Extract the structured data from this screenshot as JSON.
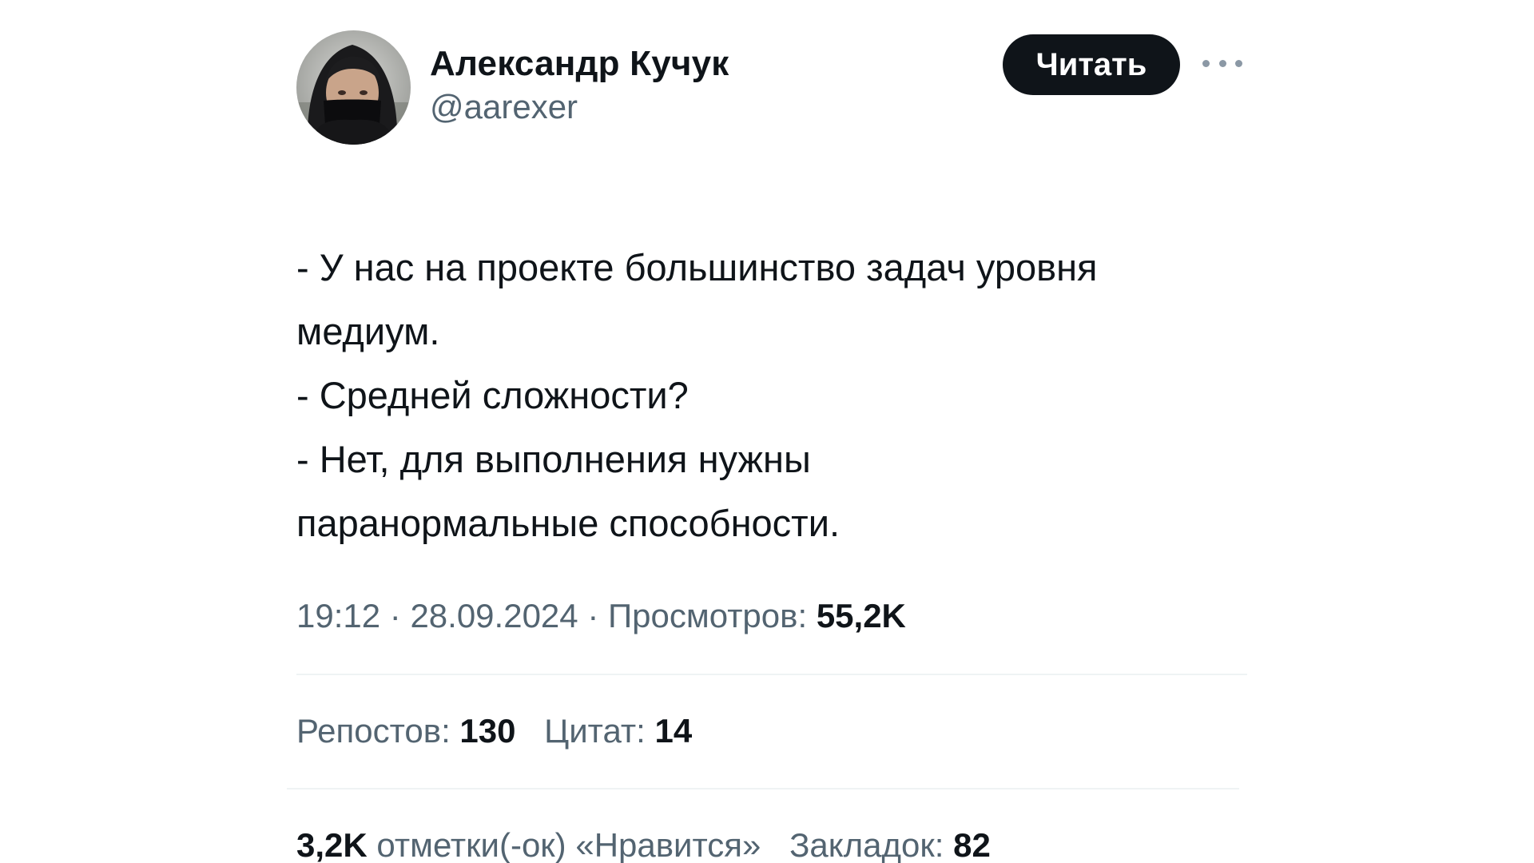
{
  "author": {
    "display_name": "Александр Кучук",
    "handle": "@aarexer",
    "avatar_icon": "masked-person-avatar"
  },
  "actions": {
    "follow_label": "Читать",
    "more_icon": "more-dots-icon"
  },
  "tweet": {
    "text": "- У нас на проекте большинство задач уровня\nмедиум.\n- Средней сложности?\n- Нет, для выполнения нужны\nпаранормальные способности."
  },
  "meta": {
    "time": "19:12",
    "separator_1": " · ",
    "date": "28.09.2024",
    "separator_2": " · ",
    "views_label": "Просмотров:",
    "views_value": "55,2K"
  },
  "stats": {
    "reposts_label": "Репостов:",
    "reposts_value": "130",
    "quotes_label": "Цитат:",
    "quotes_value": "14",
    "likes_value": "3,2K",
    "likes_label": "отметки(-ок) «Нравится»",
    "bookmarks_label": "Закладок:",
    "bookmarks_value": "82"
  },
  "colors": {
    "text_primary": "#0f1419",
    "text_secondary": "#536471",
    "button_bg": "#0f1419",
    "button_text": "#ffffff",
    "divider": "#eff3f4"
  }
}
